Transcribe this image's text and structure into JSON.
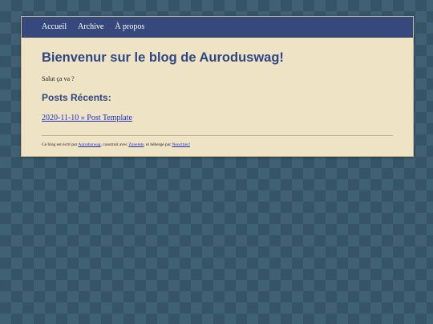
{
  "nav": {
    "items": [
      {
        "label": "Accueil"
      },
      {
        "label": "Archive"
      },
      {
        "label": "À propos"
      }
    ]
  },
  "main": {
    "title": "Bienvenur sur le blog de Auroduswag!",
    "greeting": "Salut ça va ?",
    "recent_heading": "Posts Récents:",
    "posts": [
      {
        "label": "2020-11-10 » Post Template"
      }
    ]
  },
  "footer": {
    "text1": "Ce blog est écrit par ",
    "author_link": "Auroduswag",
    "text2": ", construit avec ",
    "builder_link": "Zonelets",
    "text3": ", et hébergé par ",
    "host_link": "Neocities!"
  },
  "colors": {
    "background": "#3f6173",
    "navbar": "#36497c",
    "panel": "#efe3c6",
    "heading": "#2f4780",
    "link": "#1d2fc0"
  }
}
